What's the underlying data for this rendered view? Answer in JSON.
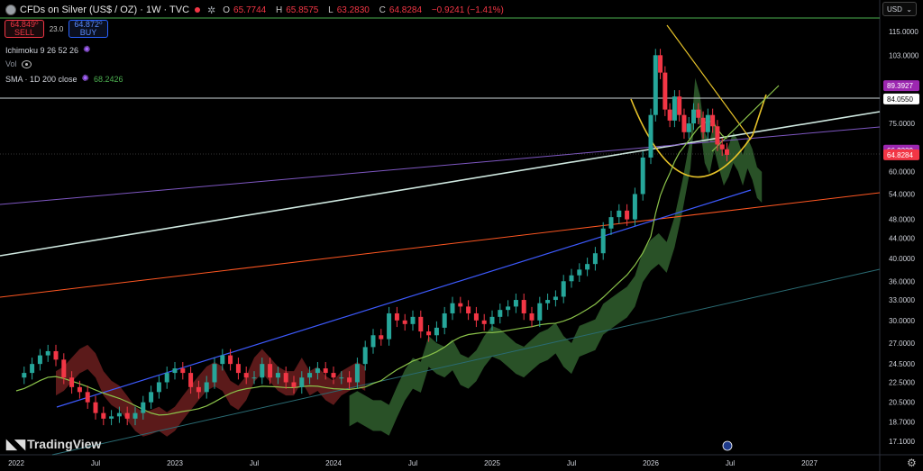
{
  "header": {
    "title": "CFDs on Silver (US$ / OZ) · 1W · TVC",
    "ohlc": [
      {
        "k": "O",
        "v": "65.7744"
      },
      {
        "k": "H",
        "v": "65.8575"
      },
      {
        "k": "L",
        "v": "63.2830"
      },
      {
        "k": "C",
        "v": "64.8284"
      }
    ],
    "change": "−0.9241 (−1.41%)"
  },
  "trade": {
    "sell_price": "64.849⁰",
    "sell_label": "SELL",
    "spread": "23.0",
    "buy_price": "64.872⁰",
    "buy_label": "BUY"
  },
  "indicators": {
    "ichimoku": "Ichimoku 9 26 52 26",
    "vol": "Vol",
    "sma": "SMA · 1D 200 close",
    "sma_value": "68.2426"
  },
  "currency": "USD",
  "brand": "TradingView",
  "colors": {
    "up": "#26a69a",
    "down": "#f23645",
    "cloud_bull": "#2e5a2b",
    "cloud_bear": "#6b1e1e",
    "sma": "#8bc34a",
    "white_line": "#cfe8e0",
    "purple_line": "#7e57c2",
    "blue_line": "#3d5afe",
    "orange_line": "#ff5722",
    "teal_line": "#2a6b73",
    "yellow": "#e6c229"
  },
  "chart_data": {
    "type": "candlestick",
    "log_scale": true,
    "ylim": [
      17.1,
      125
    ],
    "y_ticks": [
      "115.0000",
      "103.0000",
      "75.0000",
      "60.0000",
      "54.0000",
      "48.0000",
      "44.0000",
      "40.0000",
      "36.0000",
      "33.0000",
      "30.0000",
      "27.0000",
      "24.5000",
      "22.5000",
      "20.5000",
      "18.7000",
      "17.1000"
    ],
    "x_labels": [
      "2022",
      "Jul",
      "2023",
      "Jul",
      "2024",
      "Jul",
      "2025",
      "Jul",
      "2026",
      "Jul",
      "2027"
    ],
    "price_labels": [
      {
        "value": 89.3927,
        "text": "89.3927",
        "color": "#9c27b0"
      },
      {
        "value": 84.055,
        "text": "84.0550",
        "color": "#ffffff"
      },
      {
        "value": 66.2229,
        "text": "66.2229",
        "color": "#9c27b0"
      },
      {
        "value": 64.8284,
        "text": "64.8284",
        "color": "#f23645"
      }
    ],
    "horizontal_lines": [
      {
        "value": 120,
        "color": "#4caf50"
      },
      {
        "value": 84.055,
        "color": "#cfd8dc"
      }
    ],
    "weekly_close": [
      {
        "t": 2022.0,
        "c": 23.0
      },
      {
        "t": 2022.05,
        "c": 23.5
      },
      {
        "t": 2022.1,
        "c": 24.5
      },
      {
        "t": 2022.15,
        "c": 25.5
      },
      {
        "t": 2022.2,
        "c": 26.0
      },
      {
        "t": 2022.25,
        "c": 25.0
      },
      {
        "t": 2022.3,
        "c": 23.0
      },
      {
        "t": 2022.35,
        "c": 22.0
      },
      {
        "t": 2022.4,
        "c": 21.5
      },
      {
        "t": 2022.45,
        "c": 20.5
      },
      {
        "t": 2022.5,
        "c": 19.5
      },
      {
        "t": 2022.55,
        "c": 19.0
      },
      {
        "t": 2022.6,
        "c": 19.2
      },
      {
        "t": 2022.65,
        "c": 19.5
      },
      {
        "t": 2022.7,
        "c": 19.0
      },
      {
        "t": 2022.75,
        "c": 19.5
      },
      {
        "t": 2022.8,
        "c": 20.5
      },
      {
        "t": 2022.85,
        "c": 21.5
      },
      {
        "t": 2022.9,
        "c": 22.5
      },
      {
        "t": 2022.95,
        "c": 23.5
      },
      {
        "t": 2023.0,
        "c": 24.0
      },
      {
        "t": 2023.05,
        "c": 23.5
      },
      {
        "t": 2023.1,
        "c": 22.0
      },
      {
        "t": 2023.15,
        "c": 21.5
      },
      {
        "t": 2023.2,
        "c": 22.5
      },
      {
        "t": 2023.25,
        "c": 24.5
      },
      {
        "t": 2023.3,
        "c": 25.5
      },
      {
        "t": 2023.35,
        "c": 24.5
      },
      {
        "t": 2023.4,
        "c": 23.5
      },
      {
        "t": 2023.45,
        "c": 23.0
      },
      {
        "t": 2023.5,
        "c": 23.0
      },
      {
        "t": 2023.55,
        "c": 24.5
      },
      {
        "t": 2023.6,
        "c": 23.0
      },
      {
        "t": 2023.65,
        "c": 23.5
      },
      {
        "t": 2023.7,
        "c": 22.5
      },
      {
        "t": 2023.75,
        "c": 22.0
      },
      {
        "t": 2023.8,
        "c": 23.0
      },
      {
        "t": 2023.85,
        "c": 23.5
      },
      {
        "t": 2023.9,
        "c": 24.0
      },
      {
        "t": 2023.95,
        "c": 23.5
      },
      {
        "t": 2024.0,
        "c": 23.0
      },
      {
        "t": 2024.05,
        "c": 23.0
      },
      {
        "t": 2024.1,
        "c": 22.5
      },
      {
        "t": 2024.15,
        "c": 24.5
      },
      {
        "t": 2024.2,
        "c": 26.5
      },
      {
        "t": 2024.25,
        "c": 28.0
      },
      {
        "t": 2024.3,
        "c": 27.5
      },
      {
        "t": 2024.35,
        "c": 31.0
      },
      {
        "t": 2024.4,
        "c": 30.0
      },
      {
        "t": 2024.45,
        "c": 29.5
      },
      {
        "t": 2024.5,
        "c": 30.5
      },
      {
        "t": 2024.55,
        "c": 28.5
      },
      {
        "t": 2024.6,
        "c": 28.0
      },
      {
        "t": 2024.65,
        "c": 29.0
      },
      {
        "t": 2024.7,
        "c": 31.0
      },
      {
        "t": 2024.75,
        "c": 32.5
      },
      {
        "t": 2024.8,
        "c": 32.0
      },
      {
        "t": 2024.85,
        "c": 31.0
      },
      {
        "t": 2024.9,
        "c": 30.0
      },
      {
        "t": 2024.95,
        "c": 29.5
      },
      {
        "t": 2025.0,
        "c": 30.5
      },
      {
        "t": 2025.05,
        "c": 31.5
      },
      {
        "t": 2025.1,
        "c": 32.0
      },
      {
        "t": 2025.15,
        "c": 33.0
      },
      {
        "t": 2025.2,
        "c": 31.0
      },
      {
        "t": 2025.25,
        "c": 30.0
      },
      {
        "t": 2025.3,
        "c": 32.5
      },
      {
        "t": 2025.35,
        "c": 33.0
      },
      {
        "t": 2025.4,
        "c": 33.5
      },
      {
        "t": 2025.45,
        "c": 36.0
      },
      {
        "t": 2025.5,
        "c": 37.0
      },
      {
        "t": 2025.55,
        "c": 38.0
      },
      {
        "t": 2025.6,
        "c": 39.0
      },
      {
        "t": 2025.65,
        "c": 41.0
      },
      {
        "t": 2025.7,
        "c": 46.0
      },
      {
        "t": 2025.75,
        "c": 48.5
      },
      {
        "t": 2025.8,
        "c": 50.0
      },
      {
        "t": 2025.85,
        "c": 48.0
      },
      {
        "t": 2025.9,
        "c": 54.0
      },
      {
        "t": 2025.95,
        "c": 64.0
      },
      {
        "t": 2026.0,
        "c": 78.0
      },
      {
        "t": 2026.03,
        "c": 103.0
      },
      {
        "t": 2026.06,
        "c": 95.0
      },
      {
        "t": 2026.09,
        "c": 80.0
      },
      {
        "t": 2026.12,
        "c": 76.0
      },
      {
        "t": 2026.15,
        "c": 85.0
      },
      {
        "t": 2026.18,
        "c": 78.0
      },
      {
        "t": 2026.21,
        "c": 72.0
      },
      {
        "t": 2026.24,
        "c": 75.0
      },
      {
        "t": 2026.27,
        "c": 80.0
      },
      {
        "t": 2026.3,
        "c": 77.0
      },
      {
        "t": 2026.33,
        "c": 72.0
      },
      {
        "t": 2026.36,
        "c": 78.0
      },
      {
        "t": 2026.39,
        "c": 74.0
      },
      {
        "t": 2026.42,
        "c": 68.0
      },
      {
        "t": 2026.45,
        "c": 66.5
      },
      {
        "t": 2026.48,
        "c": 64.8
      }
    ]
  }
}
